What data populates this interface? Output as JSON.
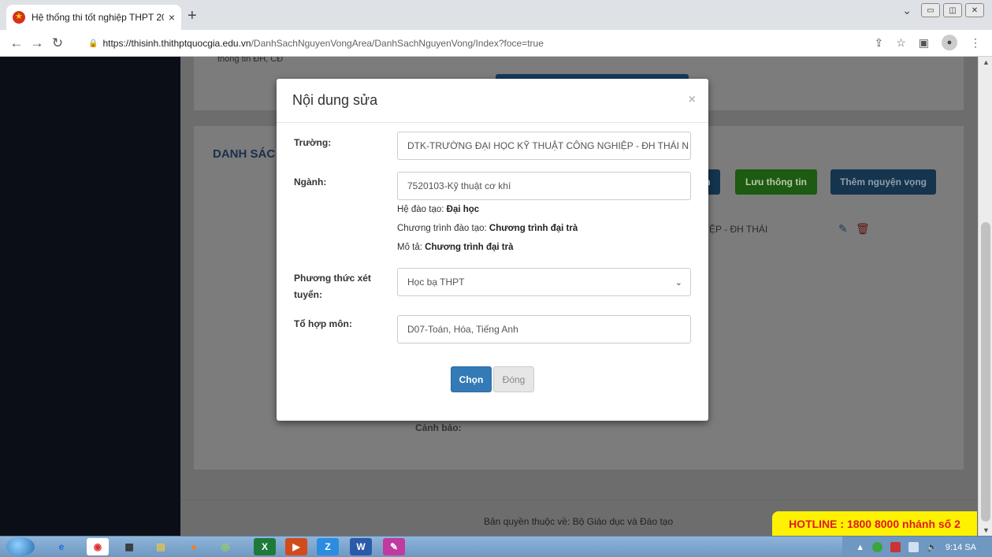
{
  "browser": {
    "tab_title": "Hệ thống thi tốt nghiệp THPT 20",
    "tab_close": "×",
    "new_tab": "+",
    "url_host": "https://thisinh.thithptquocgia.edu.vn",
    "url_path": "/DanhSachNguyenVongArea/DanhSachNguyenVong/Index?foce=true"
  },
  "page": {
    "partial_text": "thông tin ĐH, CĐ",
    "list_title": "DANH SÁC",
    "btn_partial": "h",
    "btn_save": "Lưu thông tin",
    "btn_add": "Thêm nguyện vọng",
    "row_school_partial": "HIỆP - ĐH THÁI",
    "warning_label": "Cảnh báo:",
    "footer": "Bản quyền thuộc về: Bộ Giáo dục và Đào tạo",
    "hotline": "HOTLINE : 1800 8000 nhánh số 2"
  },
  "modal": {
    "title": "Nội dung sửa",
    "close": "×",
    "school_label": "Trường:",
    "school_value": "DTK-TRƯỜNG ĐẠI HỌC KỸ THUẬT CÔNG NGHIỆP - ĐH THÁI N",
    "major_label": "Ngành:",
    "major_value": "7520103-Kỹ thuật cơ khí",
    "training_label": "Hệ đào tạo:",
    "training_value": "Đại học",
    "program_label": "Chương trình đào tạo:",
    "program_value": "Chương trình đại trà",
    "desc_label": "Mô tả:",
    "desc_value": "Chương trình đại trà",
    "method_label": "Phương thức xét tuyển:",
    "method_value": "Học bạ THPT",
    "subjects_label": "Tổ hợp môn:",
    "subjects_value": "D07-Toán, Hóa, Tiếng Anh",
    "btn_select": "Chọn",
    "btn_close": "Đóng"
  },
  "taskbar": {
    "clock": "9:14 SA"
  },
  "colors": {
    "primary": "#337ab7",
    "success": "#1d5a12",
    "hotline_bg": "#fff200",
    "hotline_text": "#e01b1b"
  },
  "icons": [
    "globe-favicon",
    "back-icon",
    "forward-icon",
    "reload-icon",
    "lock-icon",
    "share-icon",
    "star-icon",
    "sidepanel-icon",
    "profile-icon",
    "menu-icon",
    "edit-icon",
    "trash-icon"
  ]
}
